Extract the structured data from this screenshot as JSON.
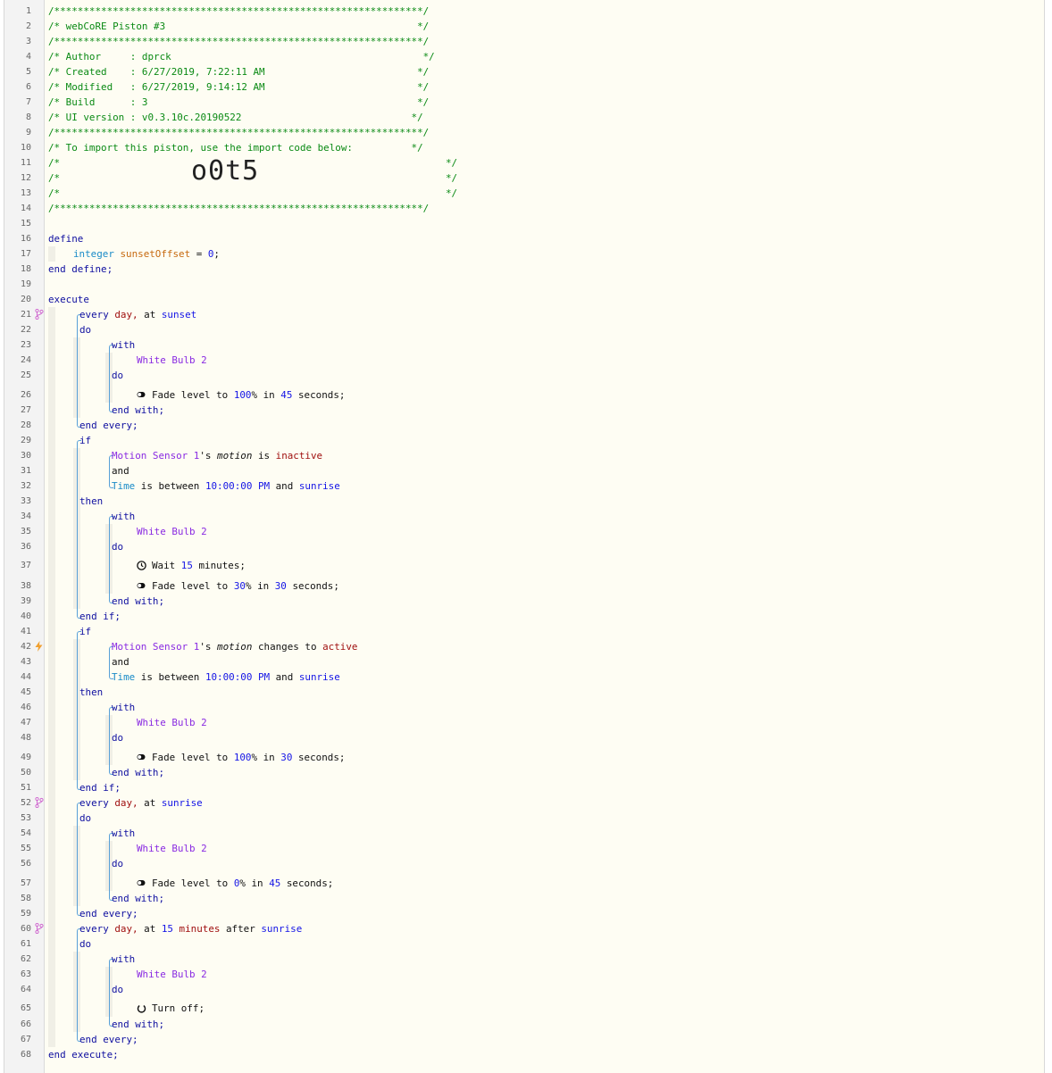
{
  "header": {
    "border": "/***************************************************************/",
    "title": "/* webCoRE Piston #3                                           */",
    "author": "/* Author     : dprck                                           */",
    "created": "/* Created    : 6/27/2019, 7:22:11 AM                          */",
    "modified": "/* Modified   : 6/27/2019, 9:14:12 AM                          */",
    "build": "/* Build      : 3                                              */",
    "ui_version": "/* UI version : v0.3.10c.20190522                             */",
    "import_hint": "/* To import this piston, use the import code below:          */",
    "blank_open": "/*",
    "blank_close": "*/",
    "import_code": "o0t5"
  },
  "kw": {
    "define": "define",
    "end_define": "end define;",
    "execute": "execute",
    "end_execute": "end execute;",
    "every": "every",
    "day": "day,",
    "at": "at",
    "do": "do",
    "with": "with",
    "end_with": "end with;",
    "end_every": "end every;",
    "if": "if",
    "then": "then",
    "and": "and",
    "end_if": "end if;",
    "integer": "integer",
    "var": "sunsetOffset",
    "assign": " = ",
    "zero": "0",
    "semi": ";",
    "sunset": "sunset",
    "sunrise": "sunrise",
    "fifteen": "15",
    "minutes": "minutes",
    "after": "after",
    "device": "White Bulb 2",
    "sensor": "Motion Sensor 1",
    "poss": "'s",
    "motion": "motion",
    "is": "is",
    "inactive": "inactive",
    "changes_to": "changes to",
    "active": "active",
    "time": "Time",
    "is_between": "is between",
    "t10pm": "10:00:00 PM",
    "fade": "Fade level to",
    "in": "in",
    "pct100": "100",
    "pct30": "30",
    "pct0": "0",
    "pct": "%",
    "s45": "45",
    "s30": "30",
    "seconds": "seconds;",
    "wait": "Wait",
    "wait_num": "15",
    "wait_unit": "minutes;",
    "turn_off": "Turn off;"
  },
  "colors": {
    "comment": "#0a8a14",
    "keyword": "#1010a0",
    "type": "#1b8cc8",
    "variable": "#c76a10",
    "number": "#1515e6",
    "device": "#8a2be2",
    "value": "#a01010",
    "bracket": "#58a0d8"
  }
}
